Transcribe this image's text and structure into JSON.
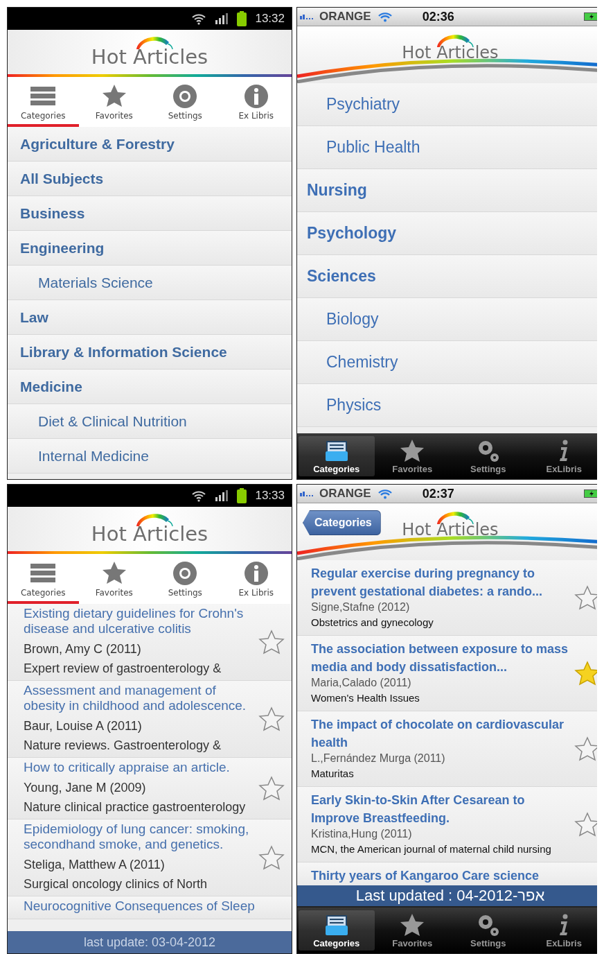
{
  "panels": [
    {
      "kind": "android",
      "status": {
        "time": "13:32"
      },
      "logo": "Hot Articles",
      "tabs": [
        {
          "label": "Categories",
          "selected": true
        },
        {
          "label": "Favorites",
          "selected": false
        },
        {
          "label": "Settings",
          "selected": false
        },
        {
          "label": "Ex Libris",
          "selected": false
        }
      ],
      "items": [
        {
          "label": "Agriculture & Forestry"
        },
        {
          "label": "All Subjects"
        },
        {
          "label": "Business"
        },
        {
          "label": "Engineering",
          "children": [
            {
              "label": "Materials Science"
            }
          ]
        },
        {
          "label": "Law"
        },
        {
          "label": "Library & Information Science"
        },
        {
          "label": "Medicine",
          "children": [
            {
              "label": "Diet & Clinical Nutrition"
            },
            {
              "label": "Internal Medicine"
            }
          ]
        }
      ]
    },
    {
      "kind": "ios",
      "status": {
        "carrier": "ORANGE",
        "time": "02:36"
      },
      "logo": "Hot Articles",
      "tabs": [
        {
          "label": "Categories",
          "selected": true
        },
        {
          "label": "Favorites",
          "selected": false
        },
        {
          "label": "Settings",
          "selected": false
        },
        {
          "label": "ExLibris",
          "selected": false
        }
      ],
      "items": [
        {
          "label": "Psychiatry",
          "kind": "subcategory"
        },
        {
          "label": "Public Health",
          "kind": "subcategory"
        },
        {
          "label": "Nursing",
          "kind": "category"
        },
        {
          "label": "Psychology",
          "kind": "category"
        },
        {
          "label": "Sciences",
          "kind": "category",
          "children": [
            {
              "label": "Biology"
            },
            {
              "label": "Chemistry"
            },
            {
              "label": "Physics"
            }
          ]
        }
      ]
    },
    {
      "kind": "android",
      "status": {
        "time": "13:33"
      },
      "logo": "Hot Articles",
      "tabs": [
        {
          "label": "Categories",
          "selected": true
        },
        {
          "label": "Favorites",
          "selected": false
        },
        {
          "label": "Settings",
          "selected": false
        },
        {
          "label": "Ex Libris",
          "selected": false
        }
      ],
      "articles": [
        {
          "title": "Existing dietary guidelines for Crohn's disease and ulcerative colitis",
          "author": "Brown, Amy C (2011)",
          "journal": "Expert review of gastroenterology &",
          "favorite": false
        },
        {
          "title": "Assessment and management of obesity in childhood and adolescence.",
          "author": "Baur, Louise A (2011)",
          "journal": "Nature reviews. Gastroenterology &",
          "favorite": false
        },
        {
          "title": "How to critically appraise an article.",
          "author": "Young, Jane M (2009)",
          "journal": "Nature clinical practice gastroenterology",
          "favorite": false
        },
        {
          "title": "Epidemiology of lung cancer: smoking, secondhand smoke, and genetics.",
          "author": "Steliga, Matthew A (2011)",
          "journal": "Surgical oncology clinics of North",
          "favorite": false
        },
        {
          "title": "Neurocognitive Consequences of Sleep"
        }
      ],
      "footer": "last update: 03-04-2012"
    },
    {
      "kind": "ios",
      "status": {
        "carrier": "ORANGE",
        "time": "02:37"
      },
      "logo": "Hot Articles",
      "back": "Categories",
      "tabs": [
        {
          "label": "Categories",
          "selected": true
        },
        {
          "label": "Favorites",
          "selected": false
        },
        {
          "label": "Settings",
          "selected": false
        },
        {
          "label": "ExLibris",
          "selected": false
        }
      ],
      "articles": [
        {
          "title": "Regular exercise during pregnancy to prevent gestational diabetes: a rando...",
          "author": "Signe,Stafne (2012)",
          "journal": "Obstetrics and gynecology",
          "favorite": false
        },
        {
          "title": "The association between exposure to mass media and body dissatisfaction...",
          "author": "Maria,Calado (2011)",
          "journal": "Women's Health Issues",
          "favorite": true
        },
        {
          "title": "The impact of chocolate on cardiovascular health",
          "author": "L.,Fernández Murga (2011)",
          "journal": "Maturitas",
          "favorite": false
        },
        {
          "title": "Early Skin-to-Skin After Cesarean to Improve Breastfeeding.",
          "author": "Kristina,Hung (2011)",
          "journal": "MCN, the American journal of maternal child nursing",
          "favorite": false
        },
        {
          "title": "Thirty years of Kangaroo Care science"
        }
      ],
      "footer": "Last updated : 04-2012-אפר"
    }
  ]
}
